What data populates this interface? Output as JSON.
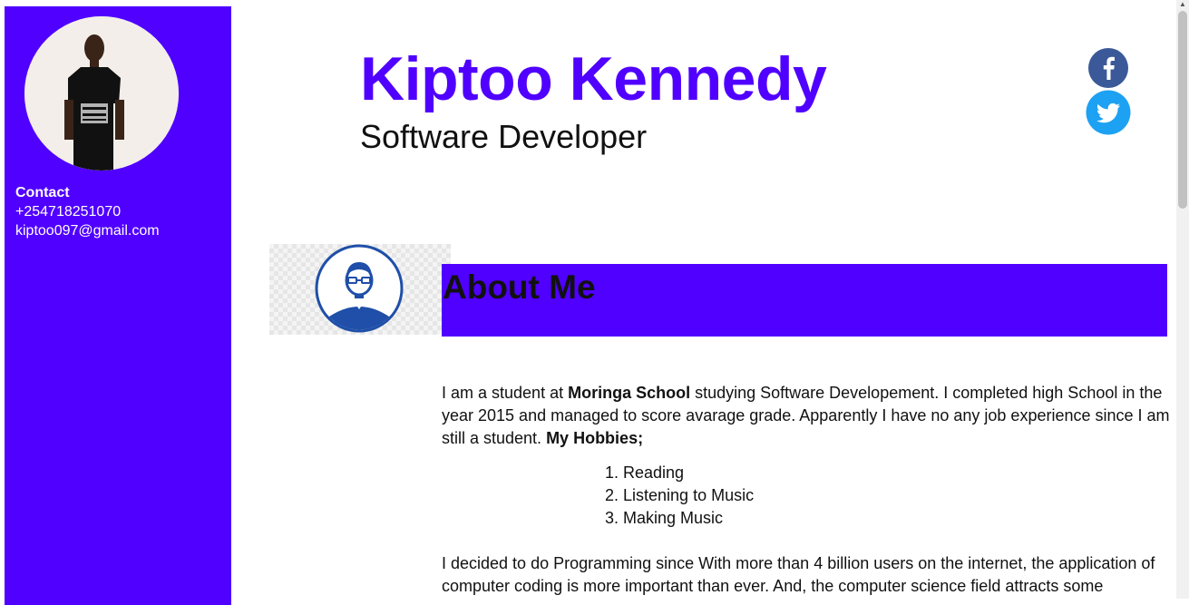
{
  "sidebar": {
    "contact_heading": "Contact",
    "phone": "+254718251070",
    "email": "kiptoo097@gmail.com",
    "accent_color": "#5000ff"
  },
  "header": {
    "name": "Kiptoo Kennedy",
    "role": "Software Developer"
  },
  "social": [
    {
      "icon": "facebook-icon",
      "color": "#3b5998"
    },
    {
      "icon": "twitter-icon",
      "color": "#1da1f2"
    }
  ],
  "about": {
    "title": "About Me",
    "intro_part1": "I am a student at ",
    "school": "Moringa School",
    "intro_part2": " studying Software Developement. I completed high School in the year 2015 and managed to score avarage grade. Apparently I have no any job experience since I am still a student. ",
    "hobbies_heading": "My Hobbies;",
    "hobbies": [
      "1. Reading",
      "2. Listening to Music",
      "3. Making Music"
    ],
    "paragraph2": "I decided to do Programming since With more than 4 billion users on the internet, the application of computer coding is more important than ever. And, the computer science field attracts some"
  }
}
